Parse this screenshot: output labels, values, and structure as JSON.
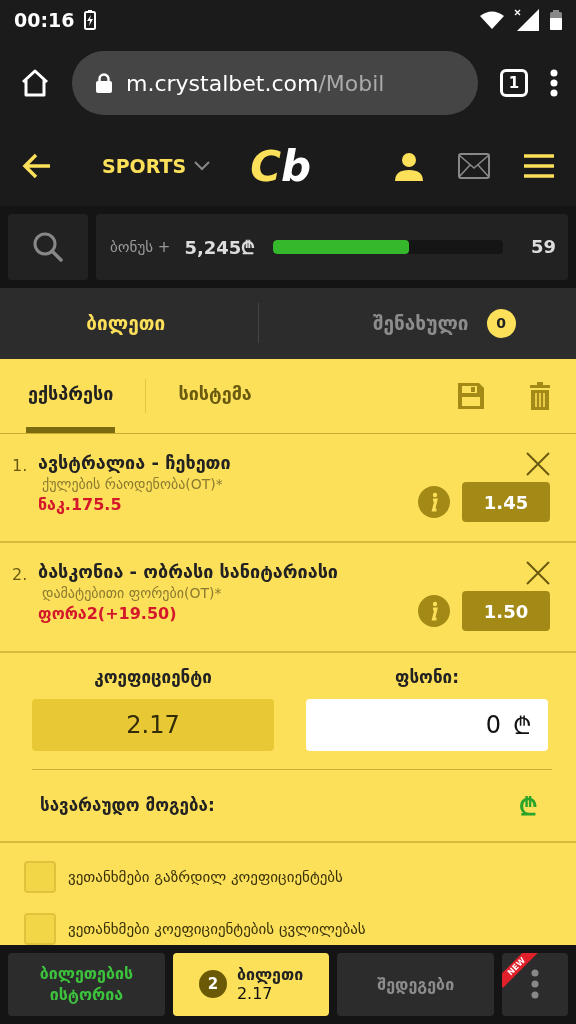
{
  "status_bar": {
    "time": "00:16"
  },
  "browser": {
    "url_host": "m.crystalbet.com",
    "url_path": "/Mobil",
    "tab_count": "1"
  },
  "header": {
    "menu_label": "SPORTS",
    "logo_c": "C",
    "logo_b": "b"
  },
  "bonus": {
    "label": "ბონუს +",
    "amount": "5,245₾",
    "level": 0.59,
    "reading": "59"
  },
  "tabs": [
    {
      "label": "ბილეთი",
      "selected": true
    },
    {
      "label": "შენახული",
      "selected": false,
      "badge": "0"
    }
  ],
  "subtabs": [
    {
      "label": "ექსპრესი",
      "selected": true
    },
    {
      "label": "სისტემა",
      "selected": false
    }
  ],
  "bets": [
    {
      "number": "1.",
      "match": "ავსტრალია - ჩეხეთი",
      "market": "ქულების რაოდენობა(OT)*",
      "pick": "ნაკ.175.5",
      "odds": "1.45"
    },
    {
      "number": "2.",
      "match": "ბასკონია - ობრასი სანიტარიასი",
      "market": "დამატებითი ფორები(OT)*",
      "pick": "ფორა2(+19.50)",
      "odds": "1.50"
    }
  ],
  "stake": {
    "odds_label": "კოეფიციენტი",
    "odds_value": "2.17",
    "stake_label": "ფსონი:",
    "stake_value": "0",
    "currency": "₾",
    "win_label": "სავარაუდო მოგება:",
    "win_currency": "₾"
  },
  "options": [
    {
      "label": "ვეთანხმები გაზრდილ კოეფიციენტებს",
      "checked": false
    },
    {
      "label": "ვეთანხმები კოეფიციენტების ცვლილებას",
      "checked": false
    }
  ],
  "bottom_nav": [
    {
      "kind": "history",
      "label": "ბილეთების ისტორია",
      "selected": false
    },
    {
      "kind": "slip",
      "label": "ბილეთი",
      "count": "2",
      "value": "2.17",
      "selected": true
    },
    {
      "kind": "plain",
      "label": "შედეგები",
      "selected": false
    },
    {
      "kind": "more",
      "badge": "NEW",
      "selected": false
    }
  ]
}
